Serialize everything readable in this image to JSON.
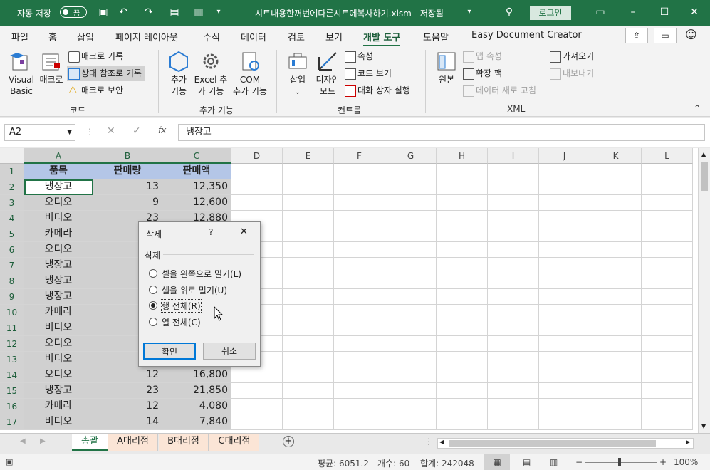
{
  "titlebar": {
    "autosave": "자동 저장",
    "toggle": "끔",
    "filename": "시트내용한꺼번에다른시트에복사하기.xlsm  -  저장됨",
    "login": "로그인"
  },
  "tabs": [
    "파일",
    "홈",
    "삽입",
    "페이지 레이아웃",
    "수식",
    "데이터",
    "검토",
    "보기",
    "개발 도구",
    "도움말",
    "Easy Document Creator"
  ],
  "ribbon": {
    "code": {
      "vb1": "Visual",
      "vb2": "Basic",
      "macro": "매크로",
      "record": "매크로 기록",
      "relative": "상대 참조로 기록",
      "security": "매크로 보안",
      "group": "코드"
    },
    "addins": {
      "add1": "추가",
      "add2": "기능",
      "excel1": "Excel 추",
      "excel2": "가 기능",
      "com1": "COM",
      "com2": "추가 기능",
      "group": "추가 기능"
    },
    "controls": {
      "insert": "삽입",
      "design1": "디자인",
      "design2": "모드",
      "props": "속성",
      "viewcode": "코드 보기",
      "dialog": "대화 상자 실행",
      "group": "컨트롤"
    },
    "xml": {
      "source": "원본",
      "mapprops": "맵 속성",
      "expansion": "확장 팩",
      "refresh": "데이터 새로 고침",
      "import": "가져오기",
      "export": "내보내기",
      "group": "XML"
    }
  },
  "formula": {
    "namebox": "A2",
    "value": "냉장고"
  },
  "columns": [
    "A",
    "B",
    "C",
    "D",
    "E",
    "F",
    "G",
    "H",
    "I",
    "J",
    "K",
    "L"
  ],
  "headers": [
    "품목",
    "판매량",
    "판매액"
  ],
  "rows": [
    [
      "냉장고",
      "13",
      "12,350"
    ],
    [
      "오디오",
      "9",
      "12,600"
    ],
    [
      "비디오",
      "23",
      "12,880"
    ],
    [
      "카메라",
      "",
      ""
    ],
    [
      "오디오",
      "",
      ""
    ],
    [
      "냉장고",
      "",
      ""
    ],
    [
      "냉장고",
      "",
      ""
    ],
    [
      "냉장고",
      "",
      ""
    ],
    [
      "카메라",
      "",
      ""
    ],
    [
      "비디오",
      "",
      ""
    ],
    [
      "오디오",
      "",
      ""
    ],
    [
      "비디오",
      "",
      ""
    ],
    [
      "오디오",
      "12",
      "16,800"
    ],
    [
      "냉장고",
      "23",
      "21,850"
    ],
    [
      "카메라",
      "12",
      "4,080"
    ],
    [
      "비디오",
      "14",
      "7,840"
    ]
  ],
  "dialog": {
    "title": "삭제",
    "help": "?",
    "close": "✕",
    "group": "삭제",
    "opts": [
      "셀을 왼쪽으로 밀기(L)",
      "셀을 위로 밀기(U)",
      "행 전체(R)",
      "열 전체(C)"
    ],
    "ok": "확인",
    "cancel": "취소"
  },
  "sheets": [
    "총괄",
    "A대리점",
    "B대리점",
    "C대리점"
  ],
  "status": {
    "avg": "평균: 6051.2",
    "count": "개수: 60",
    "sum": "합계: 242048",
    "zoom": "100%"
  }
}
